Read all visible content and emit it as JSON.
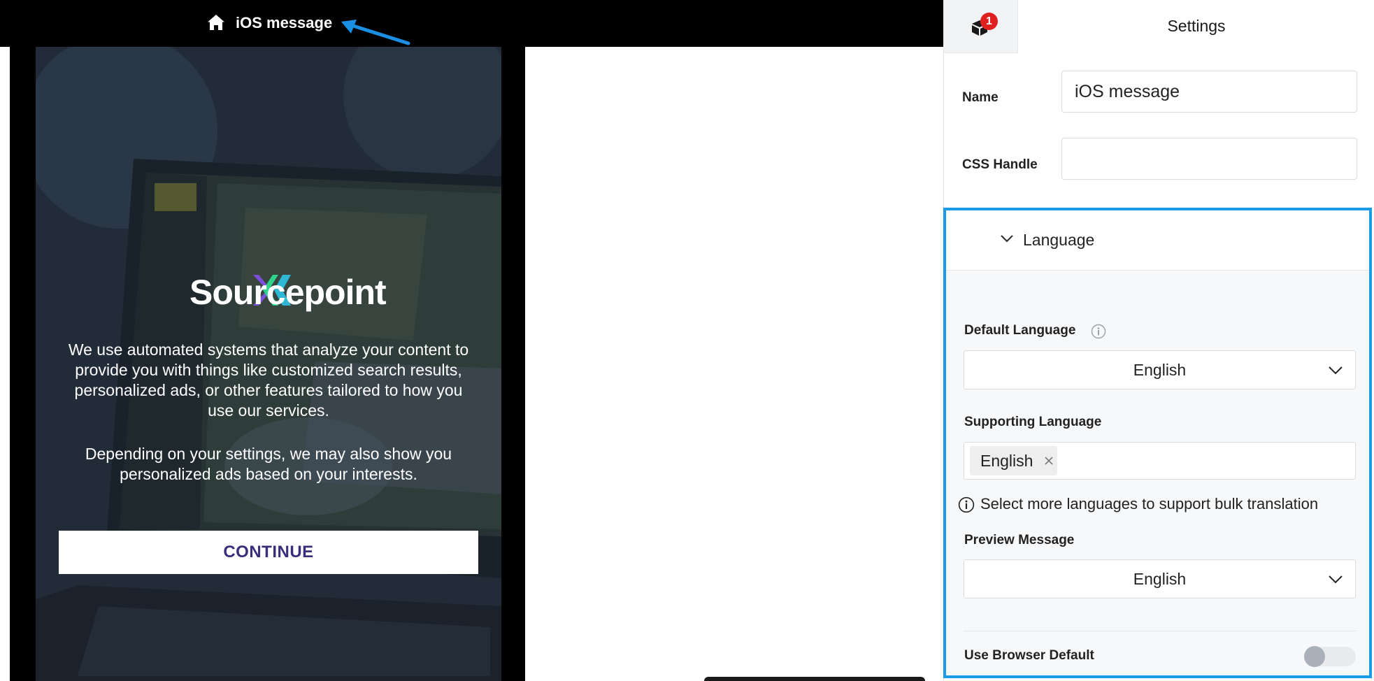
{
  "breadcrumb": {
    "icon": "home-icon",
    "title": "iOS message"
  },
  "message": {
    "logo_text": "Sourcepoint",
    "paragraph1": "We use automated systems that analyze your content to provide you with things like customized search results, personalized ads, or other features tailored to how you use our services.",
    "paragraph2": "Depending on your settings, we may also show you personalized ads based on your interests.",
    "button_label": "CONTINUE",
    "button_text_color": "#3a2d7a"
  },
  "settings": {
    "badge_count": "1",
    "title": "Settings",
    "name_label": "Name",
    "name_value": "iOS message",
    "css_handle_label": "CSS Handle",
    "css_handle_value": ""
  },
  "language": {
    "section_title": "Language",
    "default_language_label": "Default Language",
    "default_language_value": "English",
    "supporting_language_label": "Supporting Language",
    "supporting_languages": [
      "English"
    ],
    "hint": "Select more languages to support bulk translation",
    "preview_message_label": "Preview Message",
    "preview_message_value": "English",
    "use_browser_default_label": "Use Browser Default",
    "use_browser_default_on": false,
    "highlight_color": "#1a9be8"
  }
}
